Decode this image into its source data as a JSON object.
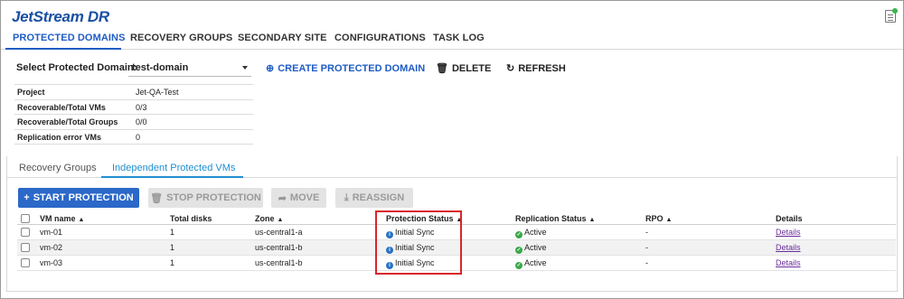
{
  "app": {
    "title": "JetStream DR"
  },
  "nav": {
    "tabs": [
      "PROTECTED DOMAINS",
      "RECOVERY GROUPS",
      "SECONDARY SITE",
      "CONFIGURATIONS",
      "TASK LOG"
    ],
    "active_index": 0
  },
  "domain_bar": {
    "label": "Select Protected Domain:",
    "selected": "test-domain",
    "actions": {
      "create": "CREATE PROTECTED DOMAIN",
      "delete": "DELETE",
      "refresh": "REFRESH"
    }
  },
  "info": [
    {
      "key": "Project",
      "value": "Jet-QA-Test"
    },
    {
      "key": "Recoverable/Total VMs",
      "value": "0/3"
    },
    {
      "key": "Recoverable/Total Groups",
      "value": "0/0"
    },
    {
      "key": "Replication error VMs",
      "value": "0"
    }
  ],
  "sub_tabs": {
    "items": [
      "Recovery Groups",
      "Independent Protected VMs"
    ],
    "active_index": 1
  },
  "toolbar": {
    "start": "START PROTECTION",
    "stop": "STOP PROTECTION",
    "move": "MOVE",
    "reassign": "REASSIGN"
  },
  "table": {
    "columns": [
      "VM name",
      "Total disks",
      "Zone",
      "Protection Status",
      "Replication Status",
      "RPO",
      "Details"
    ],
    "rows": [
      {
        "vm": "vm-01",
        "disks": "1",
        "zone": "us-central1-a",
        "protection": "Initial Sync",
        "replication": "Active",
        "rpo": "-",
        "details": "Details"
      },
      {
        "vm": "vm-02",
        "disks": "1",
        "zone": "us-central1-b",
        "protection": "Initial Sync",
        "replication": "Active",
        "rpo": "-",
        "details": "Details"
      },
      {
        "vm": "vm-03",
        "disks": "1",
        "zone": "us-central1-b",
        "protection": "Initial Sync",
        "replication": "Active",
        "rpo": "-",
        "details": "Details"
      }
    ]
  },
  "colors": {
    "brand": "#1a4fa3",
    "accent": "#1f5cc4",
    "primary_button": "#2b68c8",
    "highlight": "#d9262a",
    "status_ok": "#3aa84a",
    "status_info": "#2a73c4"
  }
}
